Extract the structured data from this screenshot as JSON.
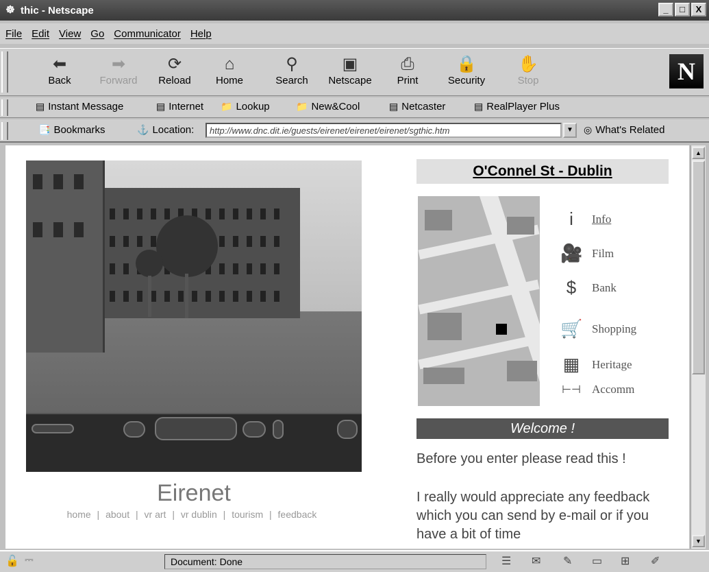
{
  "window": {
    "title": "thic - Netscape",
    "controls": [
      "_",
      "□",
      "X"
    ]
  },
  "menu": [
    "File",
    "Edit",
    "View",
    "Go",
    "Communicator",
    "Help"
  ],
  "toolbar": {
    "buttons": [
      {
        "label": "Back",
        "icon": "back-arrow-icon",
        "enabled": true
      },
      {
        "label": "Forward",
        "icon": "forward-arrow-icon",
        "enabled": false
      },
      {
        "label": "Reload",
        "icon": "reload-icon",
        "enabled": true
      },
      {
        "label": "Home",
        "icon": "home-icon",
        "enabled": true
      },
      {
        "label": "Search",
        "icon": "search-icon",
        "enabled": true
      },
      {
        "label": "Netscape",
        "icon": "netscape-icon",
        "enabled": true
      },
      {
        "label": "Print",
        "icon": "print-icon",
        "enabled": true
      },
      {
        "label": "Security",
        "icon": "lock-icon",
        "enabled": true
      },
      {
        "label": "Stop",
        "icon": "stop-icon",
        "enabled": false
      }
    ],
    "logo": "N"
  },
  "personal_toolbar": [
    "Instant Message",
    "Internet",
    "Lookup",
    "New&Cool",
    "Netcaster",
    "RealPlayer Plus"
  ],
  "location_bar": {
    "bookmarks_label": "Bookmarks",
    "location_label": "Location:",
    "url": "http://www.dnc.dit.ie/guests/eirenet/eirenet/eirenet/sgthic.htm",
    "whats_related": "What's Related"
  },
  "page": {
    "site_name": "Eirenet",
    "nav": [
      "home",
      "about",
      "vr art",
      "vr dublin",
      "tourism",
      "feedback"
    ],
    "nav_separator": "|",
    "street_title": "O'Connel St - Dublin",
    "legend": [
      {
        "icon": "info-icon",
        "glyph": "i",
        "label": "Info"
      },
      {
        "icon": "film-camera-icon",
        "glyph": "🎥",
        "label": "Film"
      },
      {
        "icon": "dollar-icon",
        "glyph": "$",
        "label": "Bank"
      },
      {
        "icon": "shopping-cart-icon",
        "glyph": "🛒",
        "label": "Shopping"
      },
      {
        "icon": "heritage-building-icon",
        "glyph": "▦",
        "label": "Heritage"
      },
      {
        "icon": "bed-icon",
        "glyph": "⊢⊣",
        "label": "Accomm"
      }
    ],
    "welcome": "Welcome !",
    "intro": "Before you enter please read this !",
    "body_text": "I really would appreciate any feedback which you can send by e-mail or if you have a bit of time"
  },
  "status": {
    "text": "Document: Done"
  }
}
